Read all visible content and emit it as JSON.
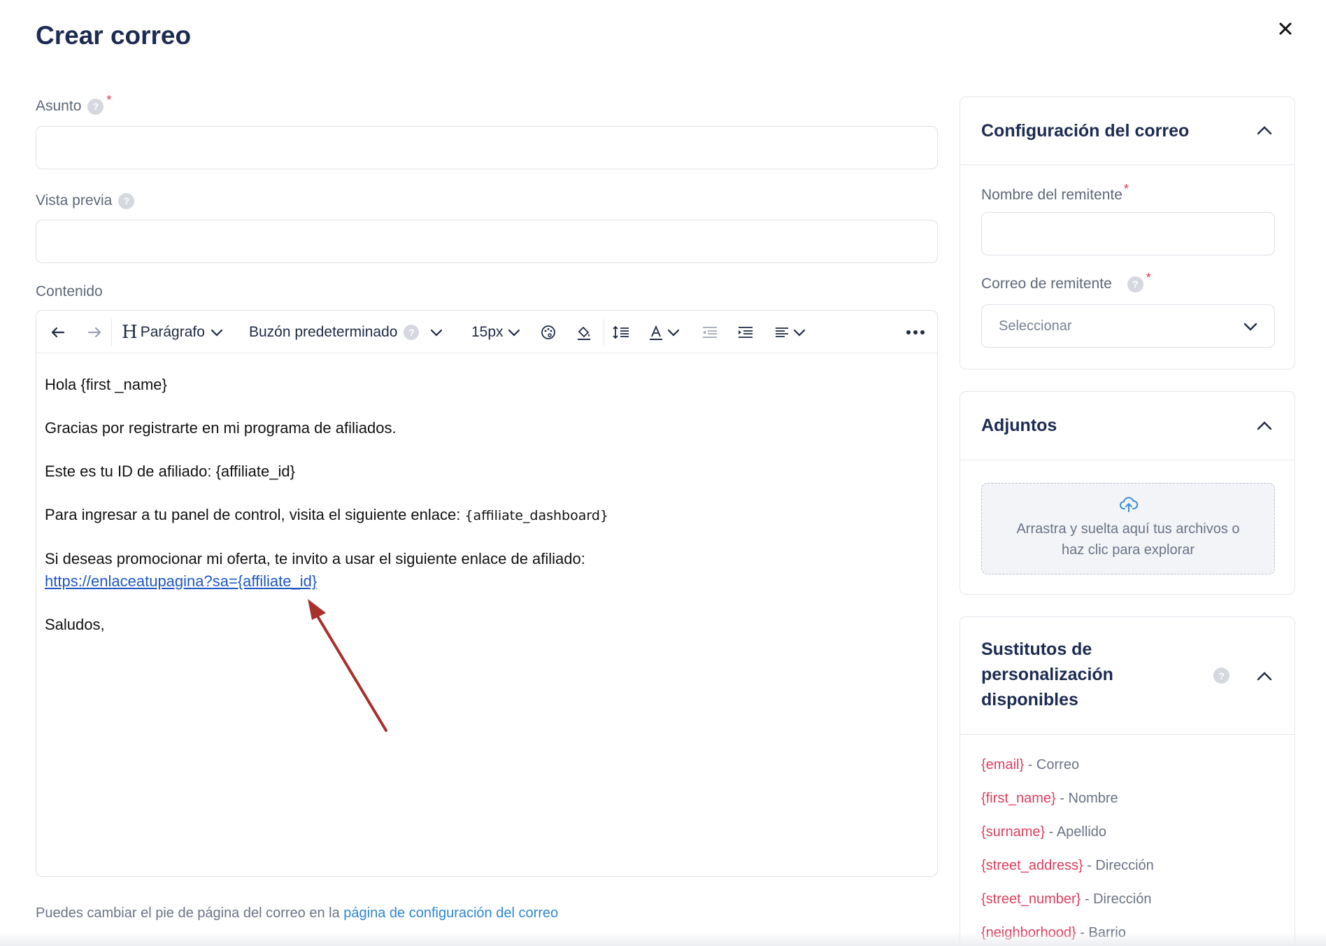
{
  "page": {
    "title": "Crear correo"
  },
  "form": {
    "subject_label": "Asunto",
    "preview_label": "Vista previa",
    "content_label": "Contenido",
    "help_glyph": "?",
    "required_mark": "*"
  },
  "toolbar": {
    "paragraph_label": "Parágrafo",
    "paragraph_h": "H",
    "mailbox_label": "Buzón predeterminado",
    "font_size": "15px"
  },
  "body_content": {
    "greeting": "Hola {first _name}",
    "line1": "Gracias por registrarte en mi programa de afiliados.",
    "line2": "Este es tu ID de afiliado: {affiliate_id}",
    "line3_text": "Para ingresar a tu panel de control, visita el siguiente enlace: ",
    "line3_token": "{affiliate_dashboard}",
    "line4": "Si deseas promocionar mi oferta, te invito a usar el siguiente enlace de afiliado:",
    "link": "https://enlaceatupagina?sa={affiliate_id}",
    "closing": "Saludos,"
  },
  "footer": {
    "note_text": "Puedes cambiar el pie de página del correo en la ",
    "note_link": "página de configuración del correo"
  },
  "config_card": {
    "title": "Configuración del correo",
    "sender_name_label": "Nombre del remitente",
    "sender_email_label": "Correo de remitente",
    "select_placeholder": "Seleccionar"
  },
  "attachments_card": {
    "title": "Adjuntos",
    "dropzone_line1": "Arrastra y suelta aquí tus archivos o",
    "dropzone_line2": "haz clic para explorar"
  },
  "substitutes_card": {
    "title_line1": "Sustitutos de",
    "title_line2": "personalización",
    "title_line3": "disponibles",
    "items": [
      {
        "token": "{email}",
        "desc": " - Correo"
      },
      {
        "token": "{first_name}",
        "desc": " - Nombre"
      },
      {
        "token": "{surname}",
        "desc": " - Apellido"
      },
      {
        "token": "{street_address}",
        "desc": " - Dirección"
      },
      {
        "token": "{street_number}",
        "desc": " - Dirección"
      },
      {
        "token": "{neighborhood}",
        "desc": " - Barrio"
      }
    ]
  },
  "colors": {
    "title": "#1c2b52",
    "required": "#e0354b",
    "link": "#1f57c3",
    "token": "#d9415f",
    "annotation_arrow": "#a8302a"
  }
}
